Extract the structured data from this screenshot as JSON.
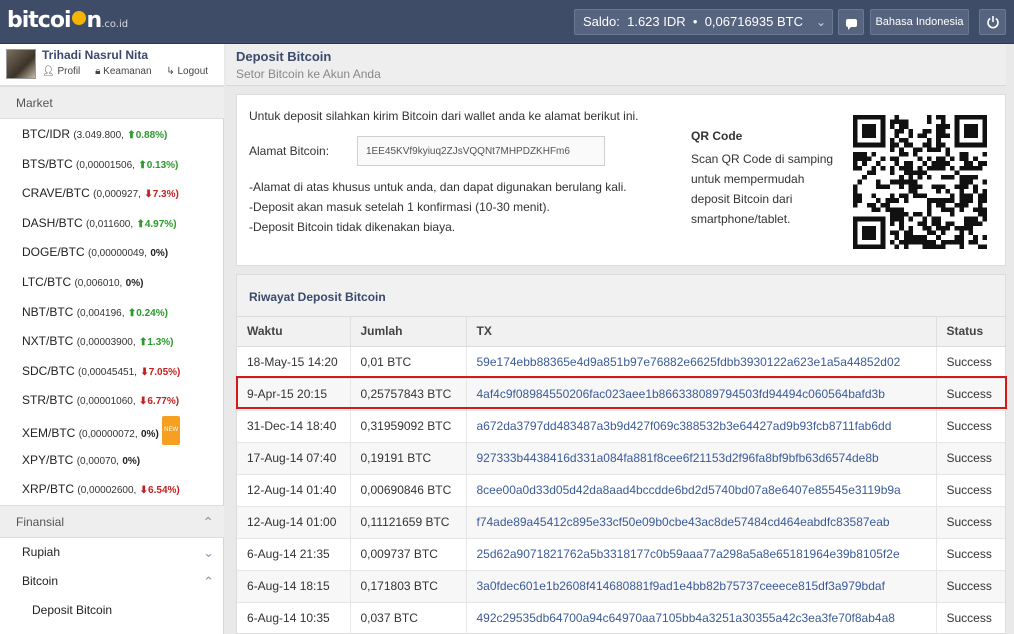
{
  "header": {
    "logo_main": "bitcoi",
    "logo_tail": "n",
    "logo_suffix": ".co.id",
    "saldo_label": "Saldo:",
    "saldo_idr": "1.623 IDR",
    "saldo_sep": "•",
    "saldo_btc": "0,06716935 BTC",
    "language": "Bahasa Indonesia"
  },
  "user": {
    "name": "Trihadi Nasrul Nita",
    "profile": "Profil",
    "security": "Keamanan",
    "logout": "Logout"
  },
  "market": {
    "title": "Market",
    "items": [
      {
        "pair": "BTC/IDR",
        "price": "(3.049.800,",
        "change": "0.88%)",
        "dir": "up"
      },
      {
        "pair": "BTS/BTC",
        "price": "(0,00001506,",
        "change": "0.13%)",
        "dir": "up"
      },
      {
        "pair": "CRAVE/BTC",
        "price": "(0,000927,",
        "change": "7.3%)",
        "dir": "down"
      },
      {
        "pair": "DASH/BTC",
        "price": "(0,011600,",
        "change": "4.97%)",
        "dir": "up"
      },
      {
        "pair": "DOGE/BTC",
        "price": "(0,00000049,",
        "change": "0%)",
        "dir": "flat"
      },
      {
        "pair": "LTC/BTC",
        "price": "(0,006010,",
        "change": "0%)",
        "dir": "flat"
      },
      {
        "pair": "NBT/BTC",
        "price": "(0,004196,",
        "change": "0.24%)",
        "dir": "up"
      },
      {
        "pair": "NXT/BTC",
        "price": "(0,00003900,",
        "change": "1.3%)",
        "dir": "up"
      },
      {
        "pair": "SDC/BTC",
        "price": "(0,00045451,",
        "change": "7.05%)",
        "dir": "down"
      },
      {
        "pair": "STR/BTC",
        "price": "(0,00001060,",
        "change": "6.77%)",
        "dir": "down"
      },
      {
        "pair": "XEM/BTC",
        "price": "(0,00000072,",
        "change": "0%)",
        "dir": "flat",
        "badge": "NEW"
      },
      {
        "pair": "XPY/BTC",
        "price": "(0,00070,",
        "change": "0%)",
        "dir": "flat"
      },
      {
        "pair": "XRP/BTC",
        "price": "(0,00002600,",
        "change": "6.54%)",
        "dir": "down"
      }
    ]
  },
  "finance": {
    "title": "Finansial",
    "rupiah": "Rupiah",
    "bitcoin": "Bitcoin",
    "deposit": "Deposit Bitcoin"
  },
  "page": {
    "title": "Deposit Bitcoin",
    "subtitle": "Setor Bitcoin ke Akun Anda"
  },
  "deposit": {
    "intro": "Untuk deposit silahkan kirim Bitcoin dari wallet anda ke alamat berikut ini.",
    "address_label": "Alamat Bitcoin:",
    "address": "1EE45KVf9kyiuq2ZJsVQQNt7MHPDZKHFm6",
    "notes": [
      "-Alamat di atas khusus untuk anda, dan dapat digunakan berulang kali.",
      "-Deposit akan masuk setelah 1 konfirmasi (10-30 menit).",
      "-Deposit Bitcoin tidak dikenakan biaya."
    ],
    "qr_title": "QR Code",
    "qr_text": "Scan QR Code di samping untuk mempermudah deposit Bitcoin dari smartphone/tablet."
  },
  "history": {
    "title": "Riwayat Deposit Bitcoin",
    "columns": [
      "Waktu",
      "Jumlah",
      "TX",
      "Status"
    ],
    "rows": [
      [
        "18-May-15 14:20",
        "0,01 BTC",
        "59e174ebb88365e4d9a851b97e76882e6625fdbb3930122a623e1a5a44852d02",
        "Success"
      ],
      [
        "9-Apr-15 20:15",
        "0,25757843 BTC",
        "4af4c9f08984550206fac023aee1b866338089794503fd94494c060564bafd3b",
        "Success"
      ],
      [
        "31-Dec-14 18:40",
        "0,31959092 BTC",
        "a672da3797dd483487a3b9d427f069c388532b3e64427ad9b93fcb8711fab6dd",
        "Success"
      ],
      [
        "17-Aug-14 07:40",
        "0,19191 BTC",
        "927333b4438416d331a084fa881f8cee6f21153d2f96fa8bf9bfb63d6574de8b",
        "Success"
      ],
      [
        "12-Aug-14 01:40",
        "0,00690846 BTC",
        "8cee00a0d33d05d42da8aad4bccdde6bd2d5740bd07a8e6407e85545e3119b9a",
        "Success"
      ],
      [
        "12-Aug-14 01:00",
        "0,11121659 BTC",
        "f74ade89a45412c895e33cf50e09b0cbe43ac8de57484cd464eabdfc83587eab",
        "Success"
      ],
      [
        "6-Aug-14 21:35",
        "0,009737 BTC",
        "25d62a9071821762a5b3318177c0b59aaa77a298a5a8e65181964e39b8105f2e",
        "Success"
      ],
      [
        "6-Aug-14 18:15",
        "0,171803 BTC",
        "3a0fdec601e1b2608f414680881f9ad1e4bb82b75737ceeece815df3a979bdaf",
        "Success"
      ],
      [
        "6-Aug-14 10:35",
        "0,037 BTC",
        "492c29535db64700a94c64970aa7105bb4a3251a30355a42c3ea3fe70f8ab4a8",
        "Success"
      ]
    ]
  },
  "colors": {
    "topbar": "#3e4c68",
    "accent": "#3b4a6b",
    "up": "#2a9a2a",
    "down": "#c52020",
    "highlight": "#d51818"
  }
}
